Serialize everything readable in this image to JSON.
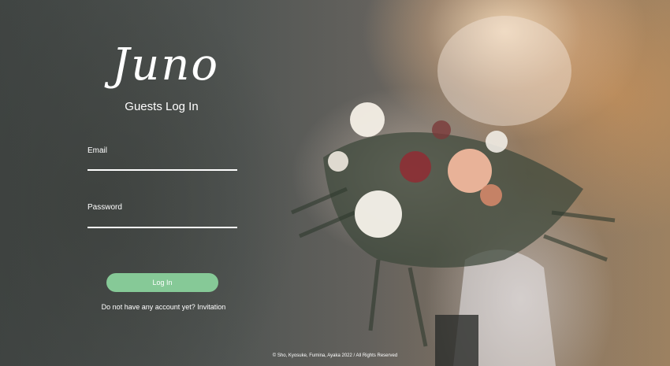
{
  "brand": {
    "logo_text": "Juno",
    "subtitle": "Guests Log In"
  },
  "form": {
    "email": {
      "label": "Email",
      "value": "",
      "placeholder": ""
    },
    "password": {
      "label": "Password",
      "value": "",
      "placeholder": ""
    },
    "login_label": "Log In"
  },
  "signup": {
    "prompt": "Do not have any account yet?",
    "link_label": "Invitation"
  },
  "footer": {
    "copyright": "© Sho, Kyosuke, Fumina, Ayaka 2022 / All Rights Reserved"
  },
  "colors": {
    "accent": "#86c997",
    "text": "#ffffff"
  }
}
